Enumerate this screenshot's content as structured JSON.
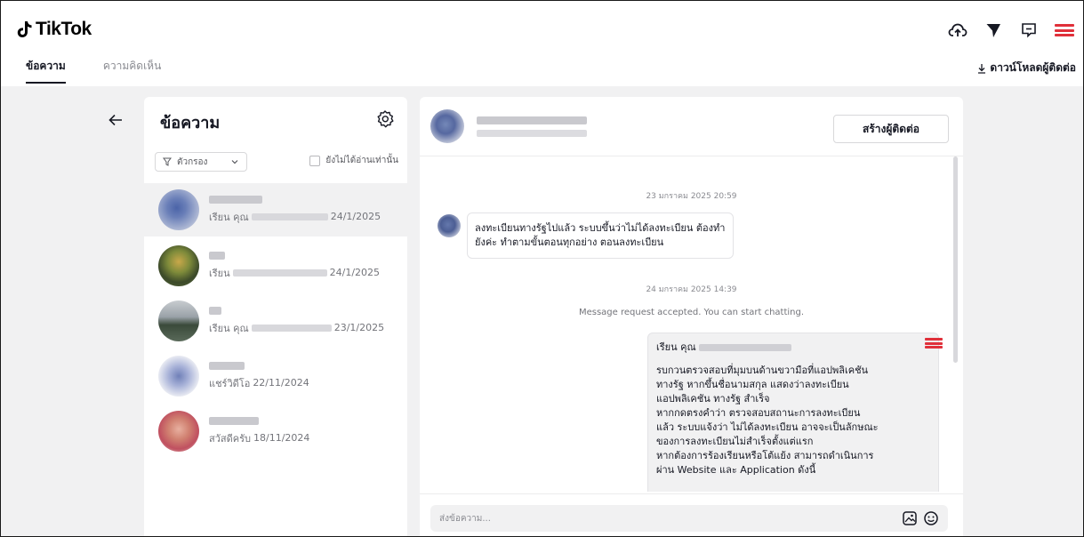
{
  "app": {
    "name": "TikTok"
  },
  "header": {
    "icons": [
      "upload-cloud-icon",
      "send-icon",
      "message-icon",
      "user-logo-icon"
    ]
  },
  "tabs": [
    {
      "label": "ข้อความ",
      "active": true
    },
    {
      "label": "ความคิดเห็น",
      "active": false
    }
  ],
  "download": {
    "label": "ดาวน์โหลดผู้ติดต่อ"
  },
  "list": {
    "title": "ข้อความ",
    "filter_label": "ตัวกรอง",
    "unread_only_label": "ยังไม่ได้อ่านเท่านั้น",
    "conversations": [
      {
        "prefix": "เรียน คุณ",
        "date": "24/1/2025"
      },
      {
        "prefix": "เรียน",
        "date": "24/1/2025"
      },
      {
        "prefix": "เรียน คุณ",
        "date": "23/1/2025"
      },
      {
        "prefix": "แชร์วิดีโอ",
        "date": "22/11/2024"
      },
      {
        "prefix": "สวัสดีครับ",
        "date": "18/11/2024"
      }
    ]
  },
  "chat": {
    "create_contact_label": "สร้างผู้ติดต่อ",
    "timestamp_1": "23 มกราคม 2025 20:59",
    "incoming_message": "ลงทะเบียนทางรัฐไปแล้ว ระบบขึ้นว่าไม่ได้ลงทะเบียน ต้องทำยังค่ะ ทำตามขั้นตอนทุกอย่าง ตอนลงทะเบียน",
    "timestamp_2": "24 มกราคม 2025 14:39",
    "system_message": "Message request accepted. You can start chatting.",
    "outgoing_greeting": "เรียน คุณ",
    "outgoing_lines": [
      "รบกวนตรวจสอบที่มุมบนด้านขวามือที่แอปพลิเคชัน",
      "ทางรัฐ หากขึ้นชื่อนามสกุล แสดงว่าลงทะเบียน",
      "แอปพลิเคชัน ทางรัฐ สำเร็จ",
      "หากกดตรงคำว่า ตรวจสอบสถานะการลงทะเบียน",
      "แล้ว ระบบแจ้งว่า ไม่ได้ลงทะเบียน อาจจะเป็นลักษณะ",
      "ของการลงทะเบียนไม่สำเร็จตั้งแต่แรก",
      "หากต้องการร้องเรียนหรือโต้แย้ง สามารถดำเนินการ",
      "ผ่าน Website และ Application ดังนี้"
    ],
    "input_placeholder": "ส่งข้อความ..."
  },
  "colors": {
    "accent_red": "#e0303a",
    "canvas": "#f1f1f2"
  }
}
